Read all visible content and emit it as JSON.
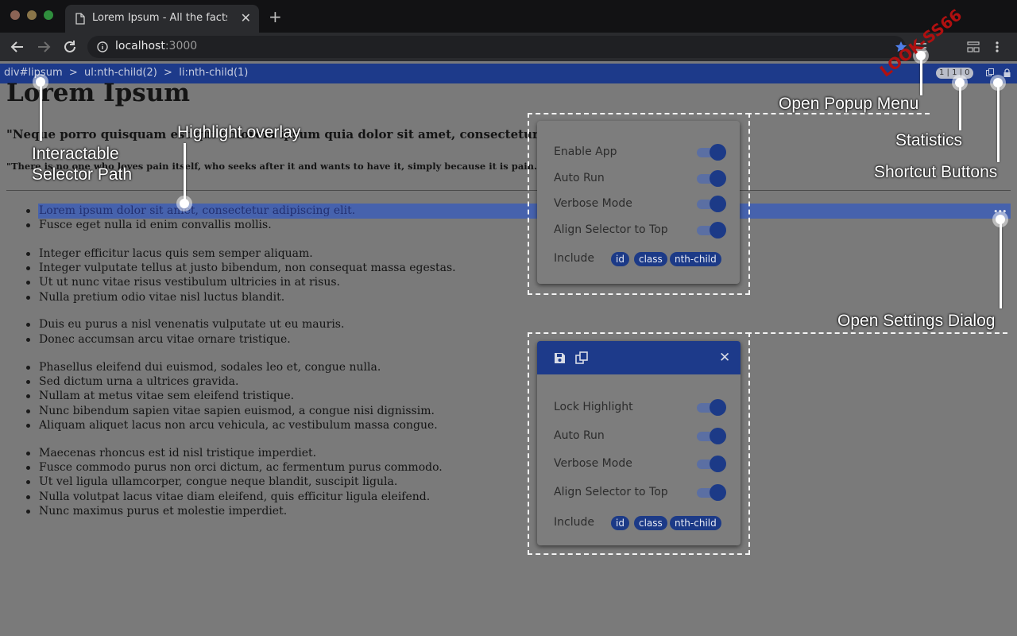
{
  "browser": {
    "tab_title": "Lorem Ipsum - All the facts - L",
    "tab_close": "✕",
    "new_tab": "+",
    "url_host": "localhost",
    "url_port": ":3000",
    "colors": {
      "close": "#9a3b2f",
      "minimize": "#8d6a2a",
      "maximize": "#1f7a2e"
    }
  },
  "extension_bar": {
    "selector_path": "div#lipsum  >  ul:nth-child(2)  >  li:nth-child(1)",
    "stats": "1 | 1 | 0"
  },
  "page": {
    "title": "Lorem Ipsum",
    "quote_1": "\"Neque porro quisquam est qui dolorem ipsum quia dolor sit amet, consectetur, adipisci velit...\"",
    "quote_2": "\"There is no one who loves pain itself, who seeks after it and wants to have it, simply because it is pain...\"",
    "list_items": [
      "Lorem ipsum dolor sit amet, consectetur adipiscing elit.",
      "Fusce eget nulla id enim convallis mollis.",
      "Integer efficitur lacus quis sem semper aliquam.",
      "Integer vulputate tellus at justo bibendum, non consequat massa egestas.",
      "Ut ut nunc vitae risus vestibulum ultricies in at risus.",
      "Nulla pretium odio vitae nisl luctus blandit.",
      "Duis eu purus a nisl venenatis vulputate ut eu mauris.",
      "Donec accumsan arcu vitae ornare tristique.",
      "Phasellus eleifend dui euismod, sodales leo et, congue nulla.",
      "Sed dictum urna a ultrices gravida.",
      "Nullam at metus vitae sem eleifend tristique.",
      "Nunc bibendum sapien vitae sapien euismod, a congue nisi dignissim.",
      "Aliquam aliquet lacus non arcu vehicula, ac vestibulum massa congue.",
      "Maecenas rhoncus est id nisl tristique imperdiet.",
      "Fusce commodo purus non orci dictum, ac fermentum purus commodo.",
      "Ut vel ligula ullamcorper, congue neque blandit, suscipit ligula.",
      "Nulla volutpat lacus vitae diam eleifend, quis efficitur ligula eleifend.",
      "Nunc maximus purus et molestie imperdiet."
    ],
    "more_dots": "•••"
  },
  "popup_menu": {
    "rows": [
      "Enable App",
      "Auto Run",
      "Verbose Mode",
      "Align Selector to Top"
    ],
    "include_label": "Include",
    "include_tags": [
      "id",
      "class",
      "nth-child"
    ]
  },
  "settings_dialog": {
    "close": "✕",
    "rows": [
      "Lock Highlight",
      "Auto Run",
      "Verbose Mode",
      "Align Selector to Top"
    ],
    "include_label": "Include",
    "include_tags": [
      "id",
      "class",
      "nth-child"
    ]
  },
  "callouts": {
    "selector_path_1": "Interactable",
    "selector_path_2": "Selector Path",
    "highlight": "Highlight overlay",
    "popup_menu": "Open Popup Menu",
    "statistics": "Statistics",
    "shortcuts": "Shortcut Buttons",
    "settings": "Open Settings Dialog"
  },
  "stamp_text": "LOOK-SS66",
  "accent_color": "#1d3a8a"
}
